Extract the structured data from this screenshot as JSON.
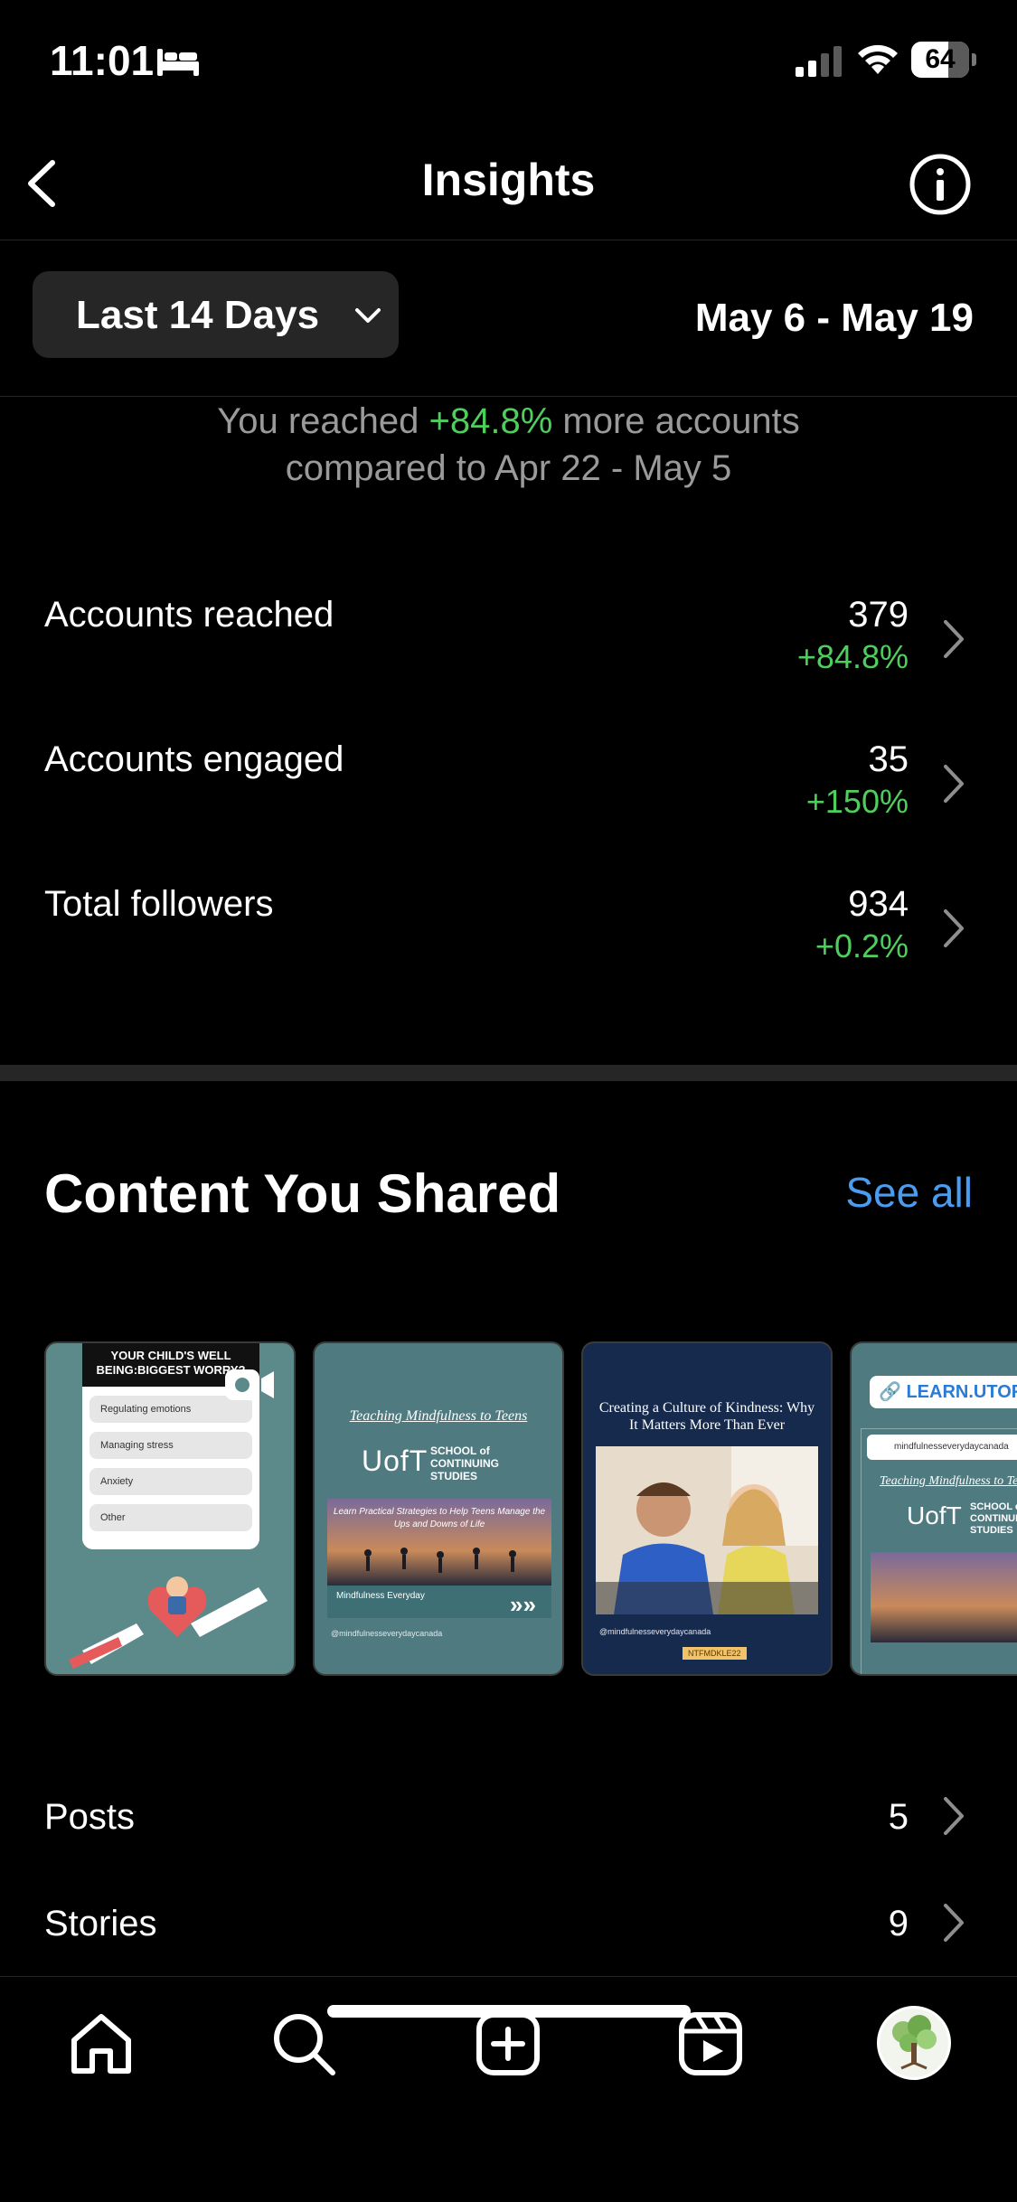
{
  "status_bar": {
    "time": "11:01",
    "battery_level": "64",
    "battery_fraction": 0.64
  },
  "header": {
    "title": "Insights"
  },
  "filter": {
    "range_label": "Last 14 Days",
    "date_range": "May 6 - May 19"
  },
  "summary": {
    "prefix": "You reached ",
    "change": "+84.8%",
    "suffix": " more accounts",
    "line2": "compared to Apr 22 - May 5"
  },
  "metrics": [
    {
      "label": "Accounts reached",
      "value": "379",
      "change": "+84.8%"
    },
    {
      "label": "Accounts engaged",
      "value": "35",
      "change": "+150%"
    },
    {
      "label": "Total followers",
      "value": "934",
      "change": "+0.2%"
    }
  ],
  "content": {
    "title": "Content You Shared",
    "see_all": "See all",
    "thumbnails": [
      {
        "header": "YOUR CHILD'S WELL BEING:BIGGEST WORRY?",
        "options": [
          "Regulating emotions",
          "Managing stress",
          "Anxiety",
          "Other"
        ]
      },
      {
        "title": "Teaching Mindfulness to Teens",
        "logo": "UofT",
        "school": "SCHOOL of CONTINUING STUDIES",
        "banner": "Learn Practical Strategies to Help Teens Manage the Ups and Downs of Life",
        "brand": "Mindfulness Everyday",
        "handle": "@mindfulnesseverydaycanada"
      },
      {
        "title": "Creating a Culture of Kindness: Why It Matters More Than Ever",
        "handle": "@mindfulnesseverydaycanada",
        "tag": "NTFMDKLE22"
      },
      {
        "url": "LEARN.UTORONTO",
        "handle": "mindfulnesseverydaycanada"
      }
    ]
  },
  "lists": [
    {
      "label": "Posts",
      "count": "5"
    },
    {
      "label": "Stories",
      "count": "9"
    }
  ],
  "tab_bar": {
    "icons": [
      "home-icon",
      "search-icon",
      "create-icon",
      "reels-icon",
      "profile-avatar"
    ]
  },
  "colors": {
    "positive": "#4fce5d",
    "link": "#4a9cf0",
    "background": "#000000"
  }
}
